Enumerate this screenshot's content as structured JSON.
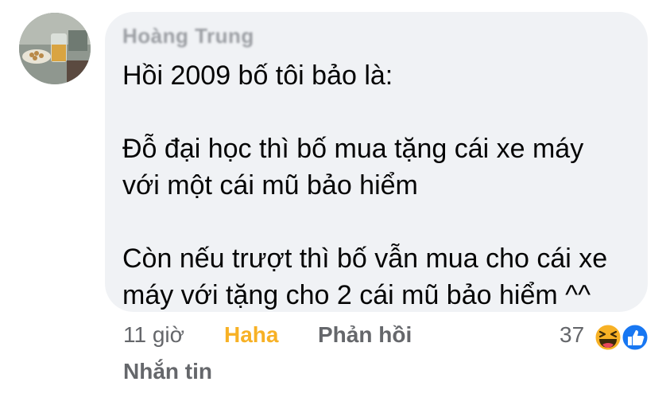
{
  "comment": {
    "author": "Hoàng Trung",
    "paragraphs": [
      "Hồi 2009 bố tôi bảo là:",
      "Đỗ đại học thì bố mua tặng cái xe máy\nvới một cái mũ bảo hiểm",
      "Còn nếu trượt thì bố vẫn mua cho cái xe\nmáy với tặng cho 2 cái mũ bảo hiểm ^^"
    ]
  },
  "actions": {
    "time": "11 giờ",
    "haha": "Haha",
    "reply": "Phản hồi",
    "message": "Nhắn tin"
  },
  "reactions": {
    "count": "37",
    "icons": [
      "haha-icon",
      "like-icon"
    ]
  },
  "colors": {
    "bubble": "#f0f2f5",
    "haha": "#f7b125",
    "like": "#1877f2",
    "secondary_text": "#65676b"
  }
}
